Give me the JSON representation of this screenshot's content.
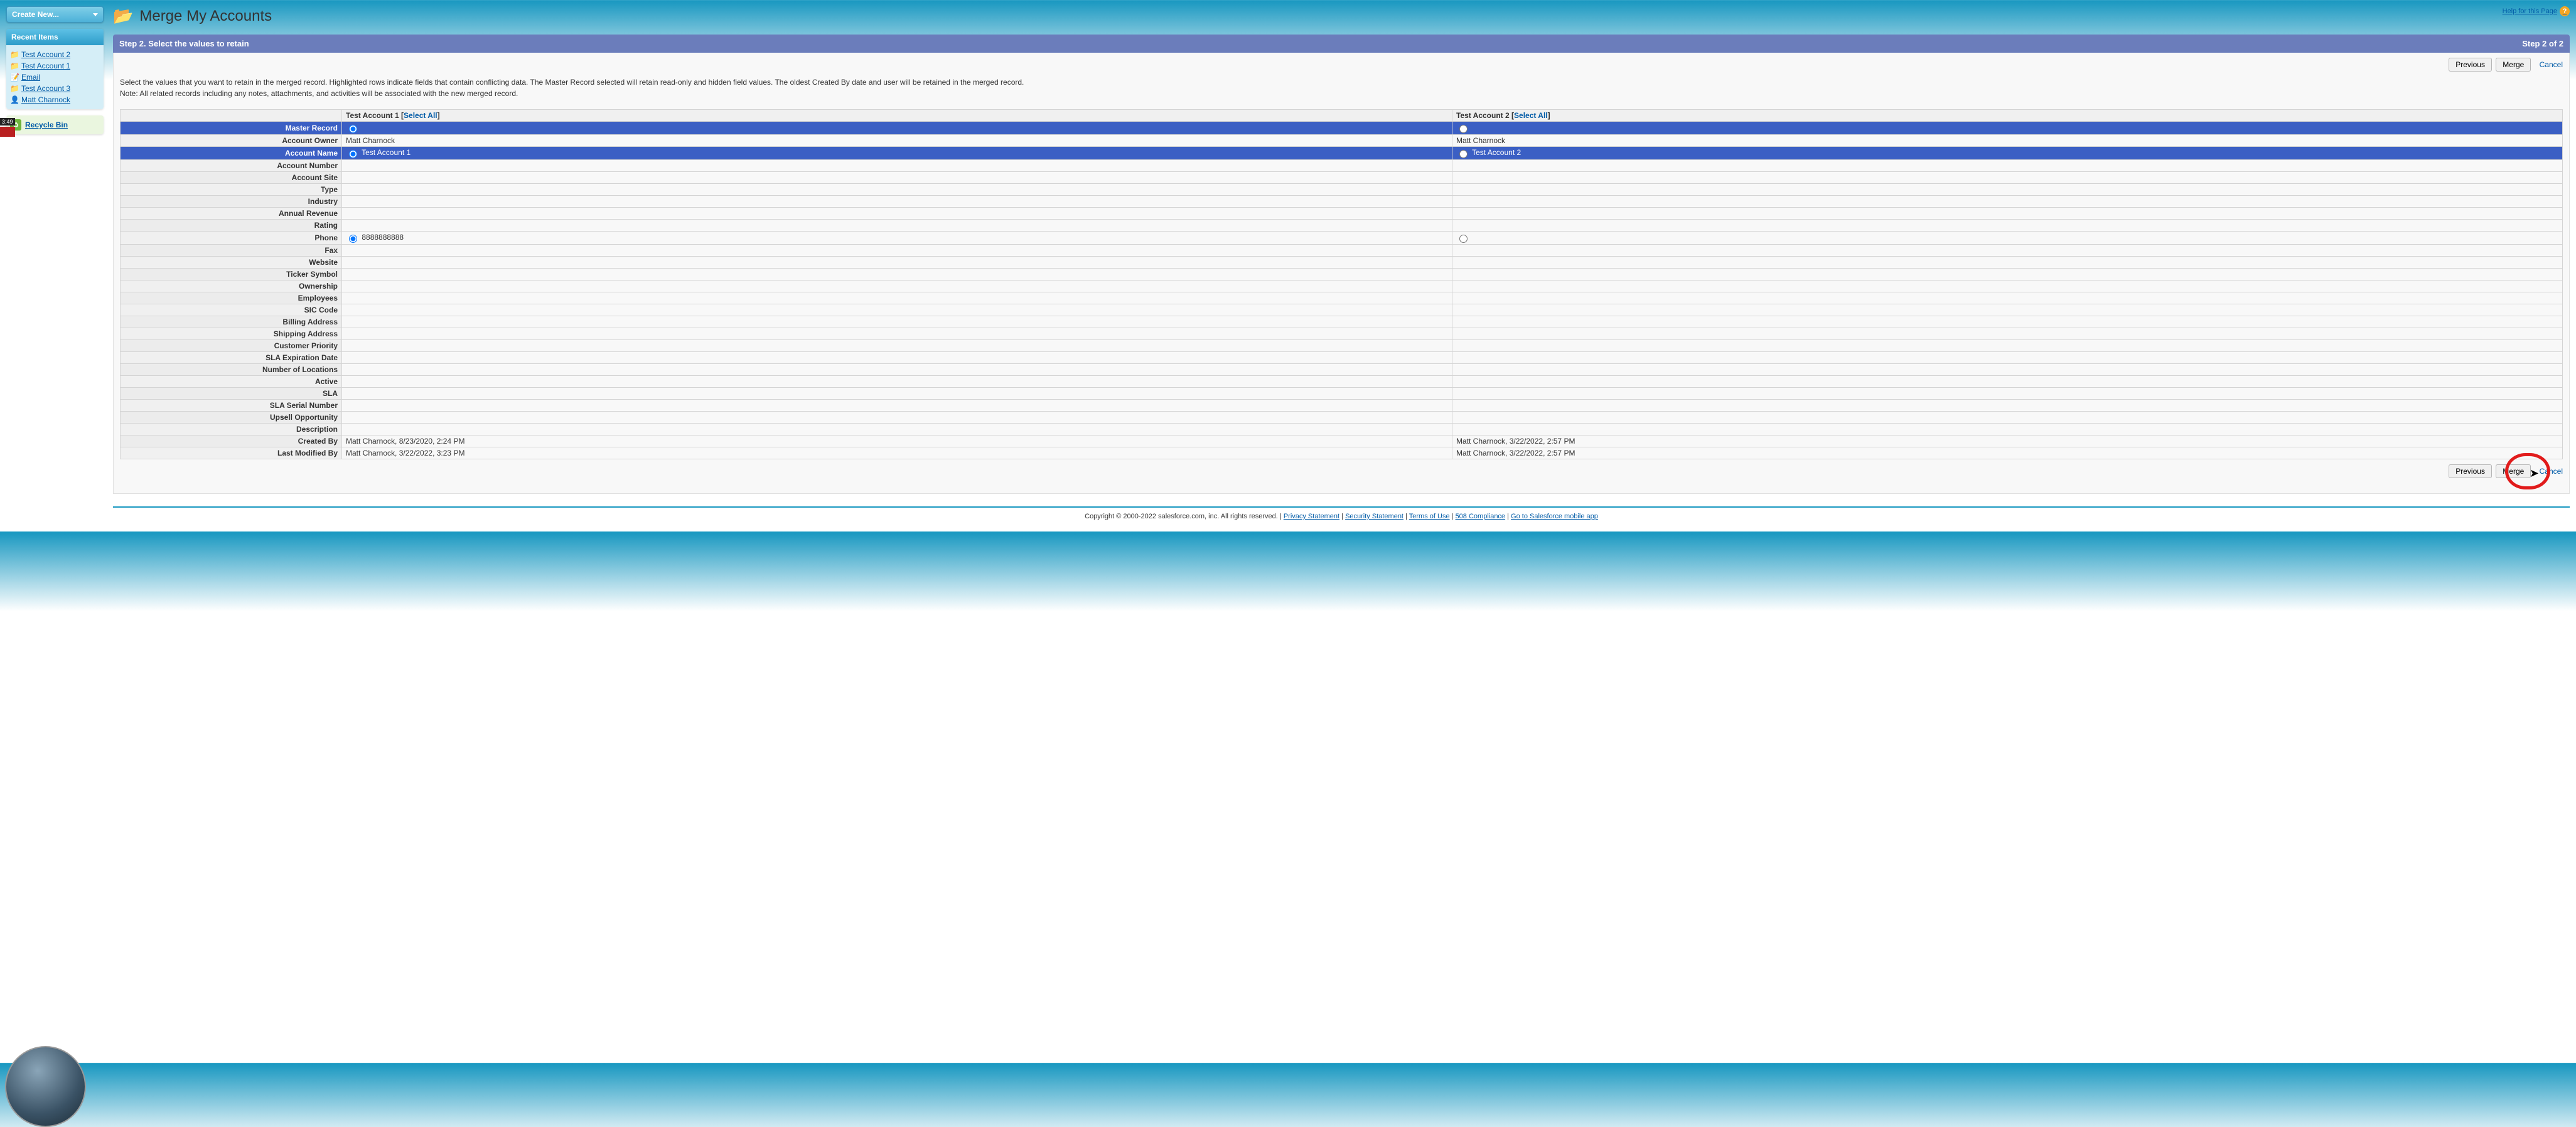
{
  "sidebar": {
    "create_new_label": "Create New...",
    "recent_header": "Recent Items",
    "recent_items": [
      {
        "label": "Test Account 2",
        "icon": "📁"
      },
      {
        "label": "Test Account 1",
        "icon": "📁"
      },
      {
        "label": "Email",
        "icon": "📝"
      },
      {
        "label": "Test Account 3",
        "icon": "📁"
      },
      {
        "label": "Matt Charnock",
        "icon": "👤"
      }
    ],
    "recycle_label": "Recycle Bin"
  },
  "header": {
    "help_label": "Help for this Page",
    "page_title": "Merge My Accounts"
  },
  "step": {
    "title": "Step 2. Select the values to retain",
    "position": "Step 2 of 2"
  },
  "buttons": {
    "previous": "Previous",
    "merge": "Merge",
    "cancel": "Cancel"
  },
  "instructions": {
    "line1": "Select the values that you want to retain in the merged record. Highlighted rows indicate fields that contain conflicting data. The Master Record selected will retain read-only and hidden field values. The oldest Created By date and user will be retained in the merged record.",
    "line2": "Note: All related records including any notes, attachments, and activities will be associated with the new merged record."
  },
  "merge": {
    "col1_name": "Test Account 1",
    "col2_name": "Test Account 2",
    "select_all": "Select All",
    "rows": {
      "master": "Master Record",
      "owner": "Account Owner",
      "owner_val1": "Matt Charnock",
      "owner_val2": "Matt Charnock",
      "name": "Account Name",
      "name_val1": "Test Account 1",
      "name_val2": "Test Account 2",
      "number": "Account Number",
      "site": "Account Site",
      "type": "Type",
      "industry": "Industry",
      "revenue": "Annual Revenue",
      "rating": "Rating",
      "phone": "Phone",
      "phone_val1": "8888888888",
      "fax": "Fax",
      "website": "Website",
      "ticker": "Ticker Symbol",
      "ownership": "Ownership",
      "employees": "Employees",
      "sic": "SIC Code",
      "billing": "Billing Address",
      "shipping": "Shipping Address",
      "priority": "Customer Priority",
      "sla_exp": "SLA Expiration Date",
      "locations": "Number of Locations",
      "active": "Active",
      "sla": "SLA",
      "sla_serial": "SLA Serial Number",
      "upsell": "Upsell Opportunity",
      "description": "Description",
      "created": "Created By",
      "created_val1": "Matt Charnock, 8/23/2020, 2:24 PM",
      "created_val2": "Matt Charnock, 3/22/2022, 2:57 PM",
      "modified": "Last Modified By",
      "modified_val1": "Matt Charnock, 3/22/2022, 3:23 PM",
      "modified_val2": "Matt Charnock, 3/22/2022, 2:57 PM"
    }
  },
  "footer": {
    "copyright": "Copyright © 2000-2022 salesforce.com, inc. All rights reserved.",
    "links": [
      "Privacy Statement",
      "Security Statement",
      "Terms of Use",
      "508 Compliance",
      "Go to Salesforce mobile app"
    ]
  },
  "overlay": {
    "timer": "3:49"
  }
}
